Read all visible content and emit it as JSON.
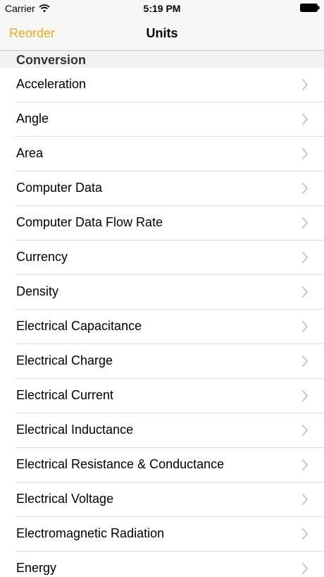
{
  "status_bar": {
    "carrier": "Carrier",
    "time": "5:19 PM",
    "wifi_icon": "wifi-icon",
    "battery_icon": "battery-icon"
  },
  "nav_bar": {
    "left_button": "Reorder",
    "title": "Units",
    "accent_color": "#f0a81c"
  },
  "section": {
    "title": "Conversion"
  },
  "list": {
    "chevron_icon": "chevron-right-icon",
    "items": [
      {
        "label": "Acceleration"
      },
      {
        "label": "Angle"
      },
      {
        "label": "Area"
      },
      {
        "label": "Computer Data"
      },
      {
        "label": "Computer Data Flow Rate"
      },
      {
        "label": "Currency"
      },
      {
        "label": "Density"
      },
      {
        "label": "Electrical Capacitance"
      },
      {
        "label": "Electrical Charge"
      },
      {
        "label": "Electrical Current"
      },
      {
        "label": "Electrical Inductance"
      },
      {
        "label": "Electrical Resistance & Conductance"
      },
      {
        "label": "Electrical Voltage"
      },
      {
        "label": "Electromagnetic Radiation"
      },
      {
        "label": "Energy"
      }
    ]
  }
}
